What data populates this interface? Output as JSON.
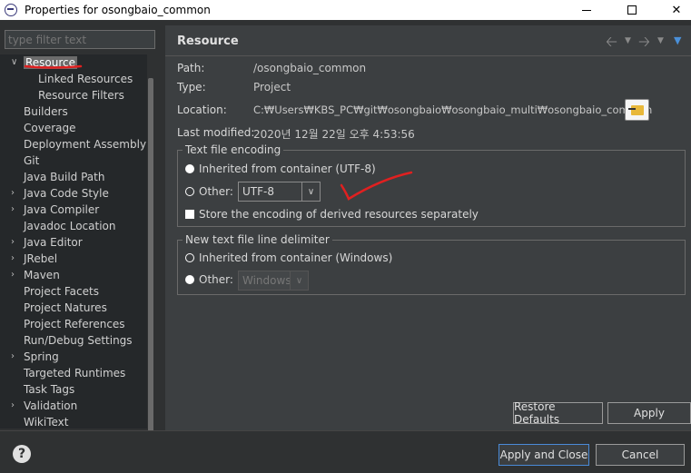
{
  "window": {
    "title": "Properties for osongbaio_common",
    "minimize_icon": "minimize-icon",
    "maximize_icon": "maximize-icon",
    "close_label": "✕"
  },
  "filter": {
    "placeholder": "type filter text"
  },
  "tree": {
    "items": [
      {
        "label": "Resource",
        "expanded": true,
        "selected": true
      },
      {
        "label": "Linked Resources"
      },
      {
        "label": "Resource Filters"
      },
      {
        "label": "Builders"
      },
      {
        "label": "Coverage"
      },
      {
        "label": "Deployment Assembly"
      },
      {
        "label": "Git"
      },
      {
        "label": "Java Build Path"
      },
      {
        "label": "Java Code Style",
        "expandable": true
      },
      {
        "label": "Java Compiler",
        "expandable": true
      },
      {
        "label": "Javadoc Location"
      },
      {
        "label": "Java Editor",
        "expandable": true
      },
      {
        "label": "JRebel",
        "expandable": true
      },
      {
        "label": "Maven",
        "expandable": true
      },
      {
        "label": "Project Facets"
      },
      {
        "label": "Project Natures"
      },
      {
        "label": "Project References"
      },
      {
        "label": "Run/Debug Settings"
      },
      {
        "label": "Spring",
        "expandable": true
      },
      {
        "label": "Targeted Runtimes"
      },
      {
        "label": "Task Tags"
      },
      {
        "label": "Validation",
        "expandable": true
      },
      {
        "label": "WikiText"
      }
    ]
  },
  "page": {
    "title": "Resource",
    "path_label": "Path:",
    "path_value": "/osongbaio_common",
    "type_label": "Type:",
    "type_value": "Project",
    "location_label": "Location:",
    "location_value": "C:₩Users₩KBS_PC₩git₩osongbaio₩osongbaio_multi₩osongbaio_common",
    "modified_label": "Last modified:",
    "modified_value": "2020년 12월 22일 오후 4:53:56"
  },
  "encoding": {
    "legend": "Text file encoding",
    "inherited_label": "Inherited from container (UTF-8)",
    "other_label": "Other:",
    "other_value": "UTF-8",
    "store_label": "Store the encoding of derived resources separately"
  },
  "delimiter": {
    "legend": "New text file line delimiter",
    "inherited_label": "Inherited from container (Windows)",
    "other_label": "Other:",
    "other_value": "Windows"
  },
  "buttons": {
    "restore_defaults": "Restore Defaults",
    "apply": "Apply",
    "apply_close": "Apply and Close",
    "cancel": "Cancel",
    "help": "?"
  },
  "colors": {
    "annotation": "#e02020",
    "accent": "#4a8ad8"
  }
}
